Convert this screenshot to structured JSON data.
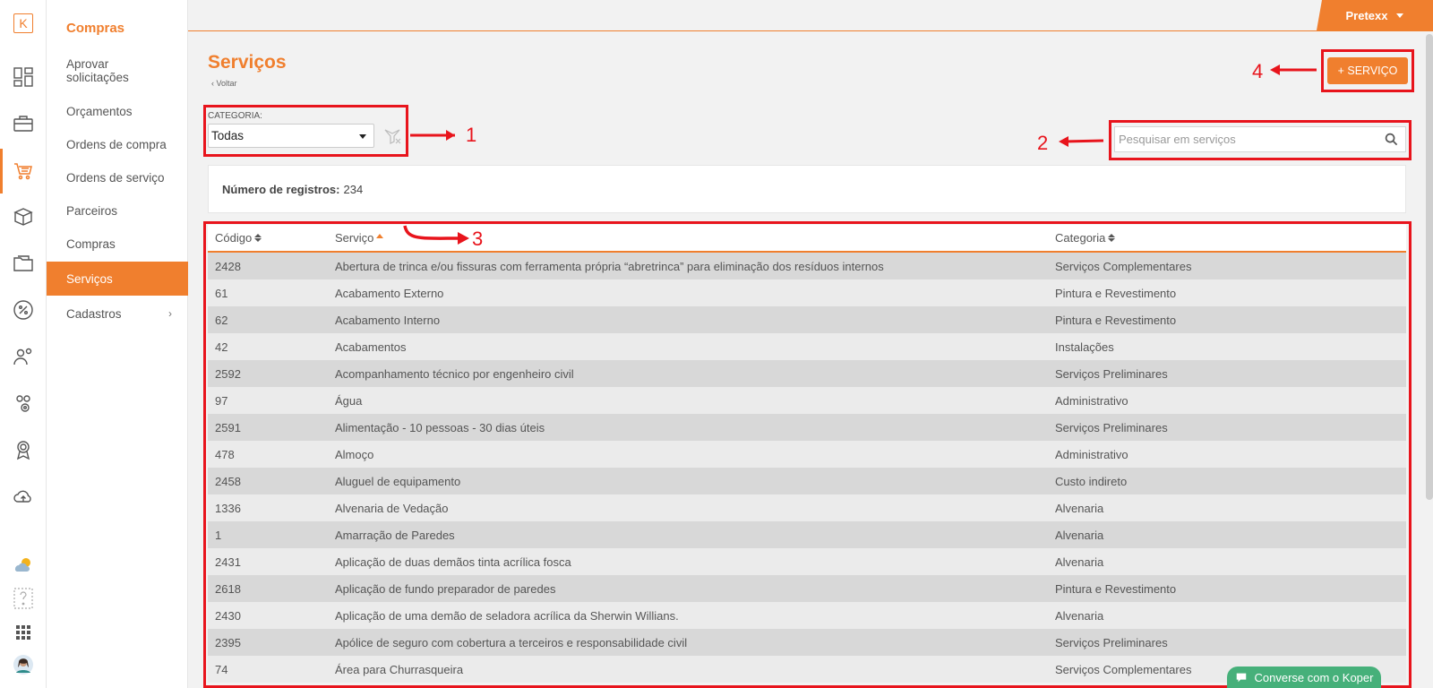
{
  "brand": {
    "logo_letter": "K",
    "accent": "#f07f2e",
    "annotation_color": "#e8141c"
  },
  "user": {
    "name": "Pretexx"
  },
  "rail_icons": [
    "dashboard-icon",
    "briefcase-icon",
    "cart-icon",
    "boxes-icon",
    "folder-icon",
    "percent-icon",
    "workers-icon",
    "settings-people-icon",
    "award-icon",
    "cloud-upload-icon",
    "weather-icon",
    "help-icon",
    "apps-grid-icon",
    "avatar"
  ],
  "nav": {
    "title": "Compras",
    "items": [
      {
        "label": "Aprovar solicitações",
        "active": false
      },
      {
        "label": "Orçamentos",
        "active": false
      },
      {
        "label": "Ordens de compra",
        "active": false
      },
      {
        "label": "Ordens de serviço",
        "active": false
      },
      {
        "label": "Parceiros",
        "active": false
      },
      {
        "label": "Compras",
        "active": false
      },
      {
        "label": "Serviços",
        "active": true
      },
      {
        "label": "Cadastros",
        "active": false,
        "submenu": true
      }
    ]
  },
  "page": {
    "title": "Serviços",
    "back_label": "Voltar",
    "add_button": "+ SERVIÇO",
    "category_label": "CATEGORIA:",
    "category_value": "Todas",
    "search_placeholder": "Pesquisar em serviços",
    "count_label": "Número de registros:",
    "count_value": "234"
  },
  "table": {
    "columns": [
      "Código",
      "Serviço",
      "Categoria"
    ],
    "sorted_column": "Serviço",
    "sort_direction": "asc",
    "rows": [
      [
        "2428",
        "Abertura de trinca e/ou fissuras com ferramenta própria “abretrinca” para eliminação dos resíduos internos",
        "Serviços Complementares"
      ],
      [
        "61",
        "Acabamento Externo",
        "Pintura e Revestimento"
      ],
      [
        "62",
        "Acabamento Interno",
        "Pintura e Revestimento"
      ],
      [
        "42",
        "Acabamentos",
        "Instalações"
      ],
      [
        "2592",
        "Acompanhamento técnico por engenheiro civil",
        "Serviços Preliminares"
      ],
      [
        "97",
        "Água",
        "Administrativo"
      ],
      [
        "2591",
        "Alimentação - 10 pessoas - 30 dias úteis",
        "Serviços Preliminares"
      ],
      [
        "478",
        "Almoço",
        "Administrativo"
      ],
      [
        "2458",
        "Aluguel de equipamento",
        "Custo indireto"
      ],
      [
        "1336",
        "Alvenaria de Vedação",
        "Alvenaria"
      ],
      [
        "1",
        "Amarração de Paredes",
        "Alvenaria"
      ],
      [
        "2431",
        "Aplicação de duas demãos tinta acrílica fosca",
        "Alvenaria"
      ],
      [
        "2618",
        "Aplicação de fundo preparador de paredes",
        "Pintura e Revestimento"
      ],
      [
        "2430",
        "Aplicação de uma demão de seladora acrílica da Sherwin Willians.",
        "Alvenaria"
      ],
      [
        "2395",
        "Apólice de seguro com cobertura a terceiros e responsabilidade civil",
        "Serviços Preliminares"
      ],
      [
        "74",
        "Área para Churrasqueira",
        "Serviços Complementares"
      ]
    ]
  },
  "annotations": {
    "n1": "1",
    "n2": "2",
    "n3": "3",
    "n4": "4"
  },
  "chat": {
    "label": "Converse com o Koper"
  }
}
